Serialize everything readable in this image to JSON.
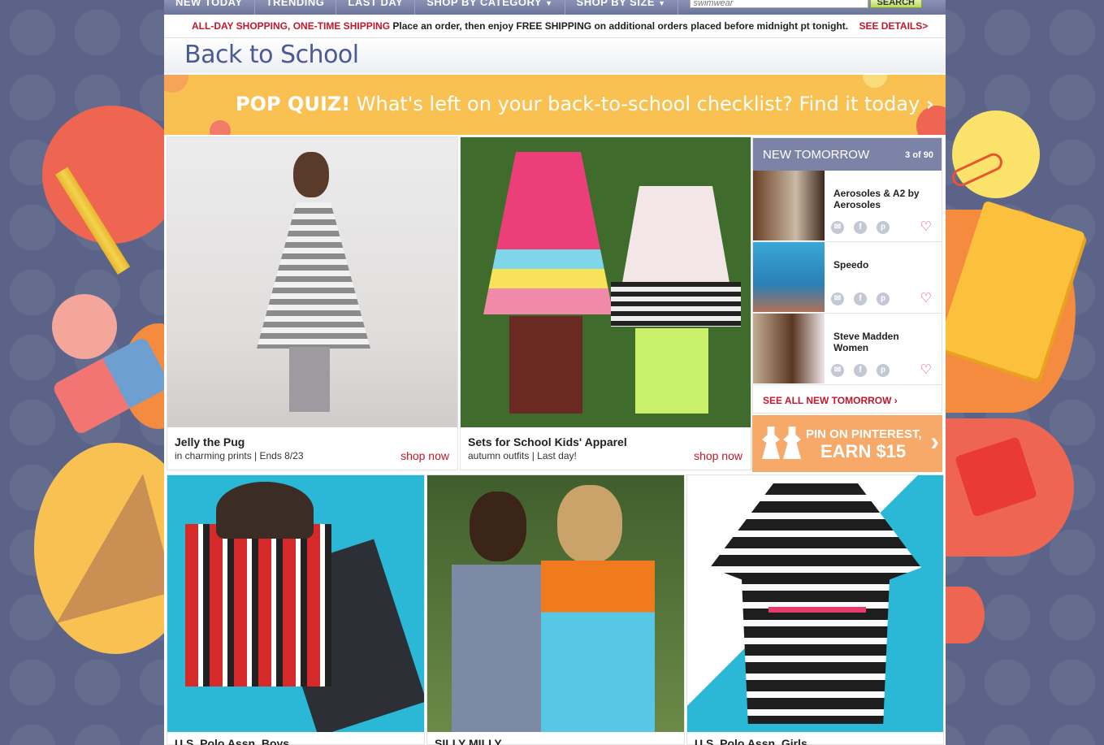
{
  "nav": {
    "tabs": [
      {
        "label": "NEW TODAY",
        "caret": false
      },
      {
        "label": "TRENDING",
        "caret": false
      },
      {
        "label": "LAST DAY",
        "caret": false
      },
      {
        "label": "SHOP BY CATEGORY",
        "caret": true
      },
      {
        "label": "SHOP BY SIZE",
        "caret": true
      }
    ],
    "search_placeholder": "swimwear",
    "search_button": "SEARCH"
  },
  "promo": {
    "headline": "ALL-DAY SHOPPING, ONE-TIME SHIPPING",
    "body": "Place an order, then enjoy FREE SHIPPING on additional orders placed before midnight pt tonight.",
    "details_link": "SEE DETAILS>"
  },
  "page_title": "Back to School",
  "quiz_banner": {
    "bold": "POP QUIZ!",
    "text": "What's left on your back-to-school checklist? Find it today",
    "arrow": "›"
  },
  "tiles": [
    {
      "name": "Jelly the Pug",
      "sub": "in charming prints | Ends 8/23",
      "shop": "shop now"
    },
    {
      "name": "Sets for School Kids' Apparel",
      "sub": "autumn outfits | Last day!",
      "shop": "shop now"
    },
    {
      "name": "U.S. Polo Assn. Boys",
      "sub": "",
      "shop": ""
    },
    {
      "name": "SILLY MILLY",
      "sub": "",
      "shop": ""
    },
    {
      "name": "U.S. Polo Assn. Girls",
      "sub": "",
      "shop": ""
    }
  ],
  "new_tomorrow": {
    "title": "NEW TOMORROW",
    "count": "3 of 90",
    "items": [
      {
        "name": "Aerosoles & A2 by Aerosoles"
      },
      {
        "name": "Speedo"
      },
      {
        "name": "Steve Madden Women"
      }
    ],
    "see_all": "SEE ALL NEW TOMORROW ›"
  },
  "pinterest": {
    "line1": "PIN ON PINTEREST,",
    "line2": "EARN $15",
    "arrow": "›"
  },
  "colors": {
    "accent_red": "#c2182b",
    "title_blue": "#4a5a98",
    "banner_yellow": "#f9c152",
    "pin_orange": "#f6a968",
    "background": "#5b6488"
  },
  "icons": [
    "email-icon",
    "facebook-icon",
    "pinterest-icon",
    "heart-icon"
  ]
}
